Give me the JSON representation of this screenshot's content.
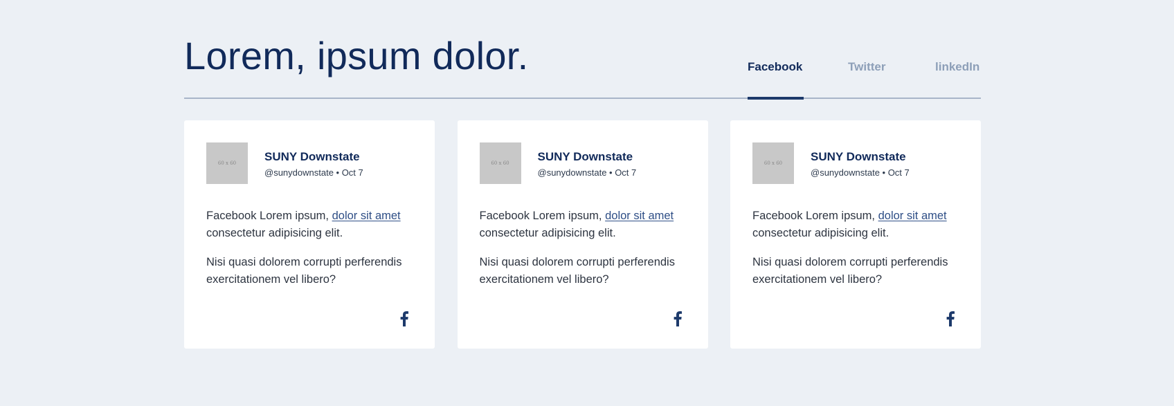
{
  "header": {
    "title": "Lorem, ipsum dolor."
  },
  "tabs": [
    {
      "label": "Facebook",
      "active": true
    },
    {
      "label": "Twitter",
      "active": false
    },
    {
      "label": "linkedIn",
      "active": false
    }
  ],
  "colors": {
    "page_background": "#ecf0f5",
    "title": "#112a5a",
    "tab_inactive": "#8d9fb8",
    "tab_indicator": "#1d3a6b",
    "link": "#2e4e86"
  },
  "cards": [
    {
      "avatar_text": "60 x 60",
      "author": "SUNY Downstate",
      "handle": "@sunydownstate • Oct 7",
      "p1_before": "Facebook Lorem ipsum, ",
      "p1_link": "dolor sit amet",
      "p1_after": " consectetur adipisicing elit.",
      "p2": "Nisi quasi dolorem corrupti perferendis exercitationem vel libero?",
      "icon": "facebook-icon"
    },
    {
      "avatar_text": "60 x 60",
      "author": "SUNY Downstate",
      "handle": "@sunydownstate • Oct 7",
      "p1_before": "Facebook Lorem ipsum, ",
      "p1_link": "dolor sit amet",
      "p1_after": " consectetur adipisicing elit.",
      "p2": "Nisi quasi dolorem corrupti perferendis exercitationem vel libero?",
      "icon": "facebook-icon"
    },
    {
      "avatar_text": "60 x 60",
      "author": "SUNY Downstate",
      "handle": "@sunydownstate • Oct 7",
      "p1_before": "Facebook Lorem ipsum, ",
      "p1_link": "dolor sit amet",
      "p1_after": " consectetur adipisicing elit.",
      "p2": "Nisi quasi dolorem corrupti perferendis exercitationem vel libero?",
      "icon": "facebook-icon"
    }
  ]
}
